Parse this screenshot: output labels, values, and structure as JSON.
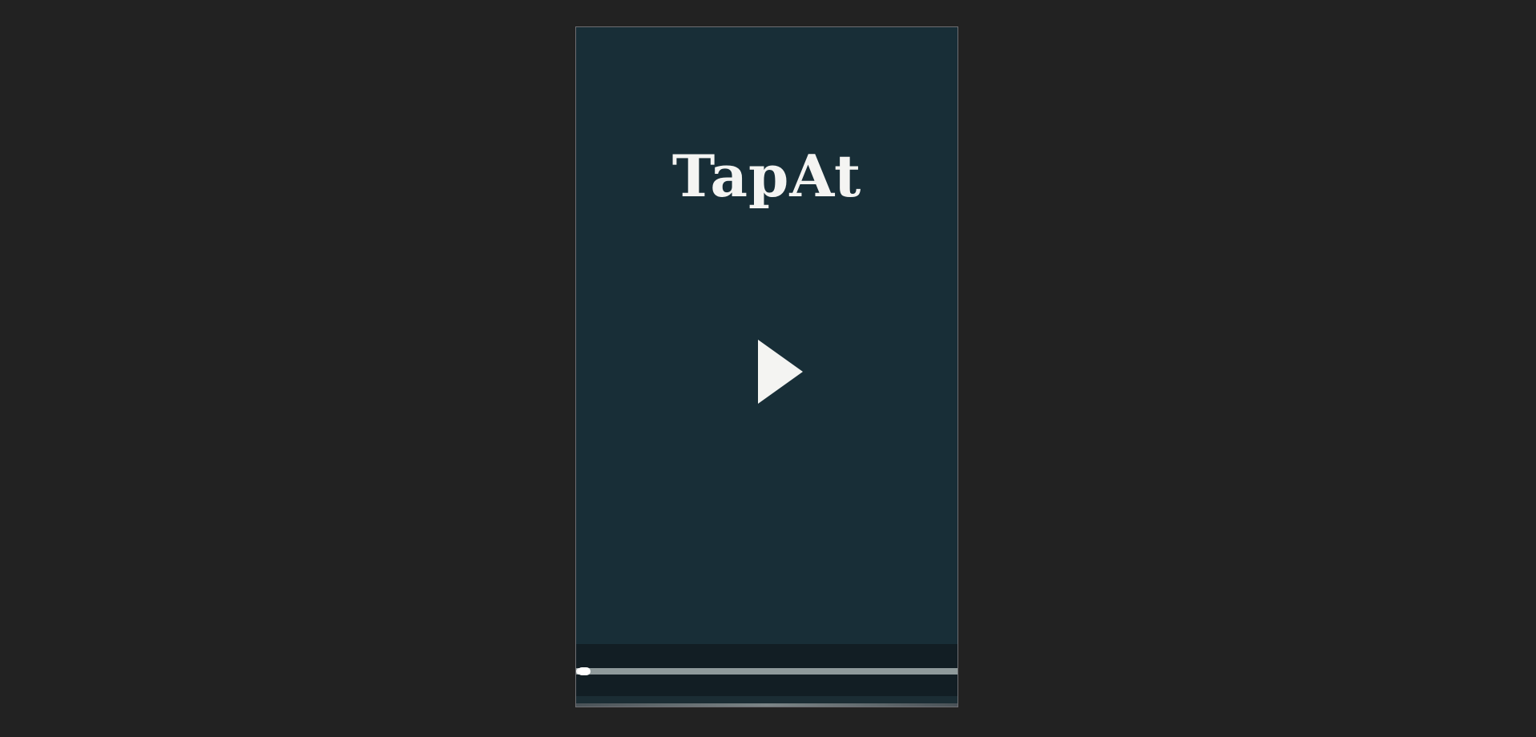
{
  "game": {
    "title": "TapAt",
    "play_icon": "play-icon",
    "progress": 0.02
  },
  "colors": {
    "page_background": "#222222",
    "game_background": "#182e37",
    "title_color": "#f4f4f2",
    "bottom_bar": "#121e24",
    "progress_track": "#8f9a9b",
    "progress_fill": "#f2f2f2"
  }
}
